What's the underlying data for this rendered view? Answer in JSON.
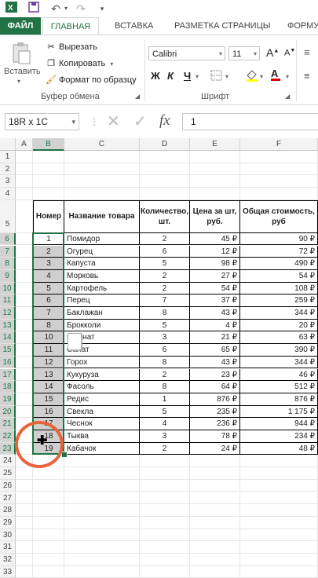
{
  "qat": {
    "save_icon": "save-icon",
    "undo_icon": "undo-icon",
    "redo_icon": "redo-icon"
  },
  "tabs": [
    "ФАЙЛ",
    "ГЛАВНАЯ",
    "ВСТАВКА",
    "РАЗМЕТКА СТРАНИЦЫ",
    "ФОРМУ"
  ],
  "ribbon": {
    "paste": "Вставить",
    "cut": "Вырезать",
    "copy": "Копировать",
    "format_painter": "Формат по образцу",
    "clipboard_group": "Буфер обмена",
    "font_name": "Calibri",
    "font_size": "11",
    "font_group": "Шрифт",
    "grow_font": "A",
    "shrink_font": "A",
    "bold": "Ж",
    "italic": "К",
    "underline": "Ч",
    "font_color_letter": "A"
  },
  "formula_bar": {
    "name_box": "18R x 1C",
    "fx": "fx",
    "value": "1"
  },
  "columns": [
    "A",
    "B",
    "C",
    "D",
    "E",
    "F"
  ],
  "rows": [
    "1",
    "2",
    "3",
    "4",
    "5",
    "6",
    "7",
    "8",
    "9",
    "10",
    "11",
    "12",
    "13",
    "14",
    "15",
    "16",
    "17",
    "18",
    "19",
    "20",
    "21",
    "22",
    "23",
    "24",
    "25",
    "26",
    "27",
    "28",
    "29",
    "30",
    "31",
    "32",
    "33"
  ],
  "table": {
    "headers": [
      "Номер",
      "Название товара",
      "Количество, шт.",
      "Цена за шт, руб.",
      "Общая стоимость, руб"
    ],
    "rows": [
      [
        "1",
        "Помидор",
        "2",
        "45 ₽",
        "90 ₽"
      ],
      [
        "2",
        "Огурец",
        "6",
        "12 ₽",
        "72 ₽"
      ],
      [
        "3",
        "Капуста",
        "5",
        "98 ₽",
        "490 ₽"
      ],
      [
        "4",
        "Морковь",
        "2",
        "27 ₽",
        "54 ₽"
      ],
      [
        "5",
        "Картофель",
        "2",
        "54 ₽",
        "108 ₽"
      ],
      [
        "6",
        "Перец",
        "7",
        "37 ₽",
        "259 ₽"
      ],
      [
        "7",
        "Баклажан",
        "8",
        "43 ₽",
        "344 ₽"
      ],
      [
        "8",
        "Брокколи",
        "5",
        "4 ₽",
        "20 ₽"
      ],
      [
        "10",
        "Шпинат",
        "3",
        "21 ₽",
        "63 ₽"
      ],
      [
        "11",
        "Салат",
        "6",
        "65 ₽",
        "390 ₽"
      ],
      [
        "12",
        "Горох",
        "8",
        "43 ₽",
        "344 ₽"
      ],
      [
        "13",
        "Кукуруза",
        "2",
        "23 ₽",
        "46 ₽"
      ],
      [
        "14",
        "Фасоль",
        "8",
        "64 ₽",
        "512 ₽"
      ],
      [
        "15",
        "Редис",
        "1",
        "876 ₽",
        "876 ₽"
      ],
      [
        "16",
        "Свекла",
        "5",
        "235 ₽",
        "1 175 ₽"
      ],
      [
        "17",
        "Чеснок",
        "4",
        "236 ₽",
        "944 ₽"
      ],
      [
        "18",
        "Тыква",
        "3",
        "78 ₽",
        "234 ₽"
      ],
      [
        "19",
        "Кабачок",
        "2",
        "24 ₽",
        "48 ₽"
      ]
    ]
  },
  "accent": "#217346"
}
